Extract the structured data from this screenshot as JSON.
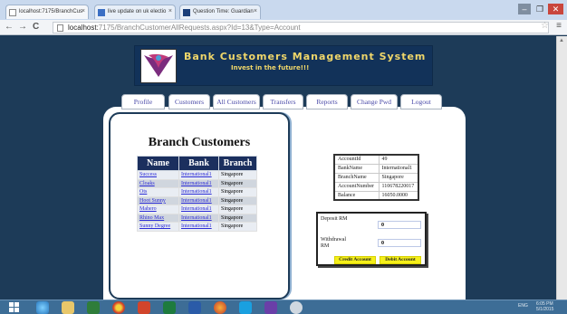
{
  "browser": {
    "tabs": [
      {
        "label": "localhost:7175/BranchCus"
      },
      {
        "label": "live update on uk electio"
      },
      {
        "label": "Question Time: Guardian"
      }
    ],
    "url_host": "localhost:",
    "url_path": "7175/BranchCustomerAllRequests.aspx?Id=13&Type=Account",
    "close_glyph": "×",
    "back_glyph": "←",
    "forward_glyph": "→",
    "reload_glyph": "C",
    "star_glyph": "☆",
    "menu_glyph": "≡",
    "minimize_glyph": "–",
    "maximize_glyph": "❐",
    "window_close_glyph": "✕",
    "scroll_up_glyph": "▲"
  },
  "site": {
    "title": "Bank Customers Management System",
    "tagline": "Invest in the future!!!"
  },
  "nav": {
    "items": [
      "Profile",
      "Customers",
      "All Customers",
      "Transfers",
      "Reports",
      "Change Pwd",
      "Logout"
    ]
  },
  "branch_panel": {
    "title": "Branch Customers",
    "columns": [
      "Name",
      "Bank",
      "Branch"
    ],
    "rows": [
      [
        "Success",
        "International1",
        "Singapore"
      ],
      [
        "Cloaks",
        "International1",
        "Singapore"
      ],
      [
        "Ots",
        "International1",
        "Singapore"
      ],
      [
        "Hoot Sunny",
        "International1",
        "Singapore"
      ],
      [
        "Mahero",
        "International1",
        "Singapore"
      ],
      [
        "Rhino Max",
        "International1",
        "Singapore"
      ],
      [
        "Sunny Degree",
        "International1",
        "Singapore"
      ]
    ]
  },
  "account": {
    "rows": [
      [
        "AccountId",
        "49"
      ],
      [
        "BankName",
        "International1"
      ],
      [
        "BranchName",
        "Singapore"
      ],
      [
        "AccountNumber",
        "110678220017"
      ],
      [
        "Balance",
        "16050.0000"
      ]
    ]
  },
  "transaction": {
    "deposit_label": "Deposit RM",
    "deposit_value": "0",
    "withdrawal_label": "Withdrawal RM",
    "withdrawal_value": "0",
    "credit_button": "Credit Account",
    "debit_button": "Debit Account"
  },
  "taskbar": {
    "lang": "ENG",
    "time": "6:05 PM",
    "date": "5/1/2015"
  },
  "colors": {
    "page_bg": "#1d3b58",
    "banner_text": "#f0d76a",
    "table_header": "#1b2f5e",
    "button_yellow": "#f5ef1a",
    "link": "#2b2bd6"
  }
}
